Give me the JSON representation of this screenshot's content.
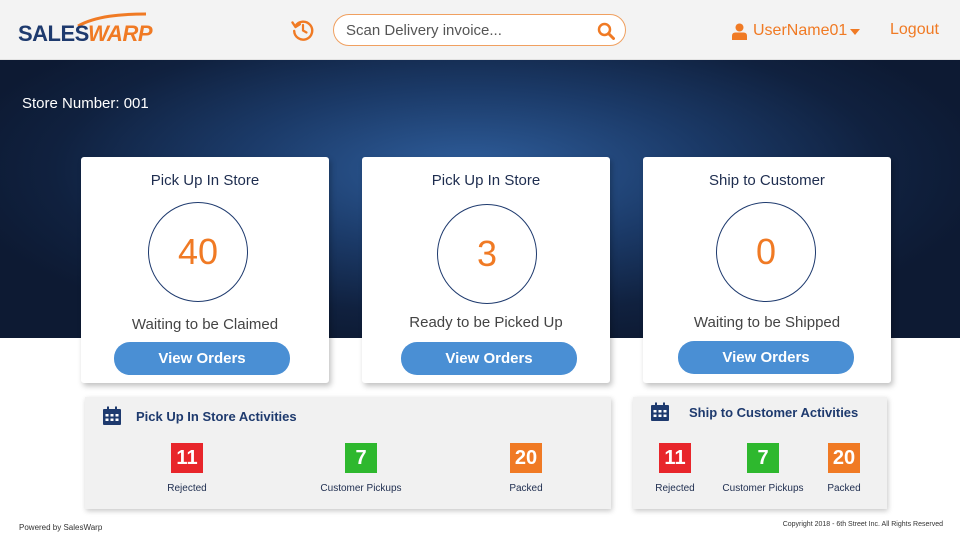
{
  "header": {
    "logo_sales": "SALES",
    "logo_warp": "WARP",
    "search_placeholder": "Scan Delivery invoice...",
    "username": "UserName01",
    "logout_label": "Logout"
  },
  "store": {
    "label": "Store Number: 001"
  },
  "cards": [
    {
      "title": "Pick Up In Store",
      "count": "40",
      "subtitle": "Waiting to be Claimed",
      "button": "View Orders"
    },
    {
      "title": "Pick Up In Store",
      "count": "3",
      "subtitle": "Ready to be Picked Up",
      "button": "View Orders"
    },
    {
      "title": "Ship to Customer",
      "count": "0",
      "subtitle": "Waiting to be Shipped",
      "button": "View Orders"
    }
  ],
  "activities": {
    "pickup": {
      "title": "Pick Up In Store Activities",
      "stats": [
        {
          "value": "11",
          "label": "Rejected"
        },
        {
          "value": "7",
          "label": "Customer Pickups"
        },
        {
          "value": "20",
          "label": "Packed"
        }
      ]
    },
    "ship": {
      "title": "Ship to Customer Activities",
      "stats": [
        {
          "value": "11",
          "label": "Rejected"
        },
        {
          "value": "7",
          "label": "Customer Pickups"
        },
        {
          "value": "20",
          "label": "Packed"
        }
      ]
    }
  },
  "colors": {
    "accent": "#f07a24",
    "navy": "#1e3a6e",
    "button_blue": "#4a8fd4",
    "rejected": "#e8262b",
    "pickups": "#2eb82e",
    "packed": "#f07a24"
  },
  "icons": {
    "history": "history-icon",
    "search": "search-icon",
    "user": "user-icon",
    "caret": "caret-down-icon",
    "calendar": "calendar-icon"
  },
  "footer": {
    "left": "Powered by SalesWarp",
    "right": "Copyright 2018 - 6th Street Inc. All Rights Reserved"
  }
}
